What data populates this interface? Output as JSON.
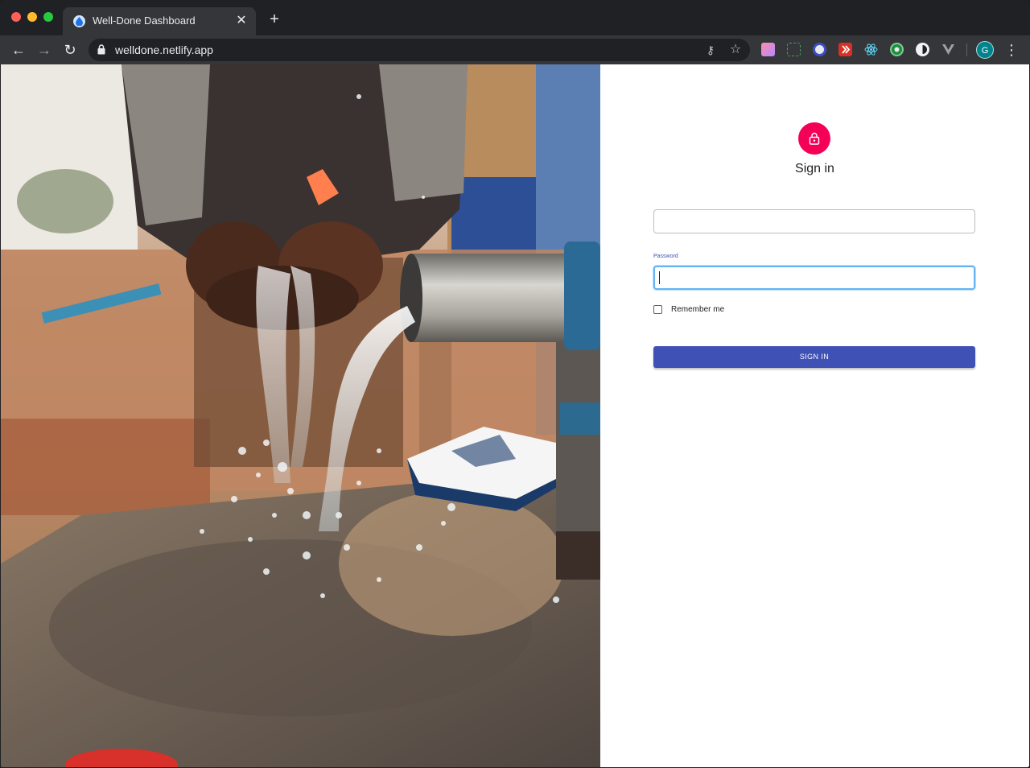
{
  "browser": {
    "tab_title": "Well-Done Dashboard",
    "tab_close": "✕",
    "new_tab": "+",
    "url": "welldone.netlify.app",
    "profile_initial": "G",
    "back": "←",
    "forward": "→",
    "reload": "↻",
    "menu": "⋮",
    "key_icon": "⚷",
    "star_icon": "☆",
    "extensions": [
      "gradient-extension-icon",
      "screenshot-extension-icon",
      "compass-extension-icon",
      "redirect-extension-icon",
      "react-devtools-icon",
      "target-extension-icon",
      "dark-reader-icon",
      "vue-devtools-icon"
    ]
  },
  "signin": {
    "title": "Sign in",
    "email_value": "",
    "password_label": "Password",
    "password_value": "",
    "remember_label": "Remember me",
    "button_label": "SIGN IN"
  },
  "colors": {
    "avatar": "#f50057",
    "primary": "#3f51b5",
    "focus": "#64b5f6"
  }
}
